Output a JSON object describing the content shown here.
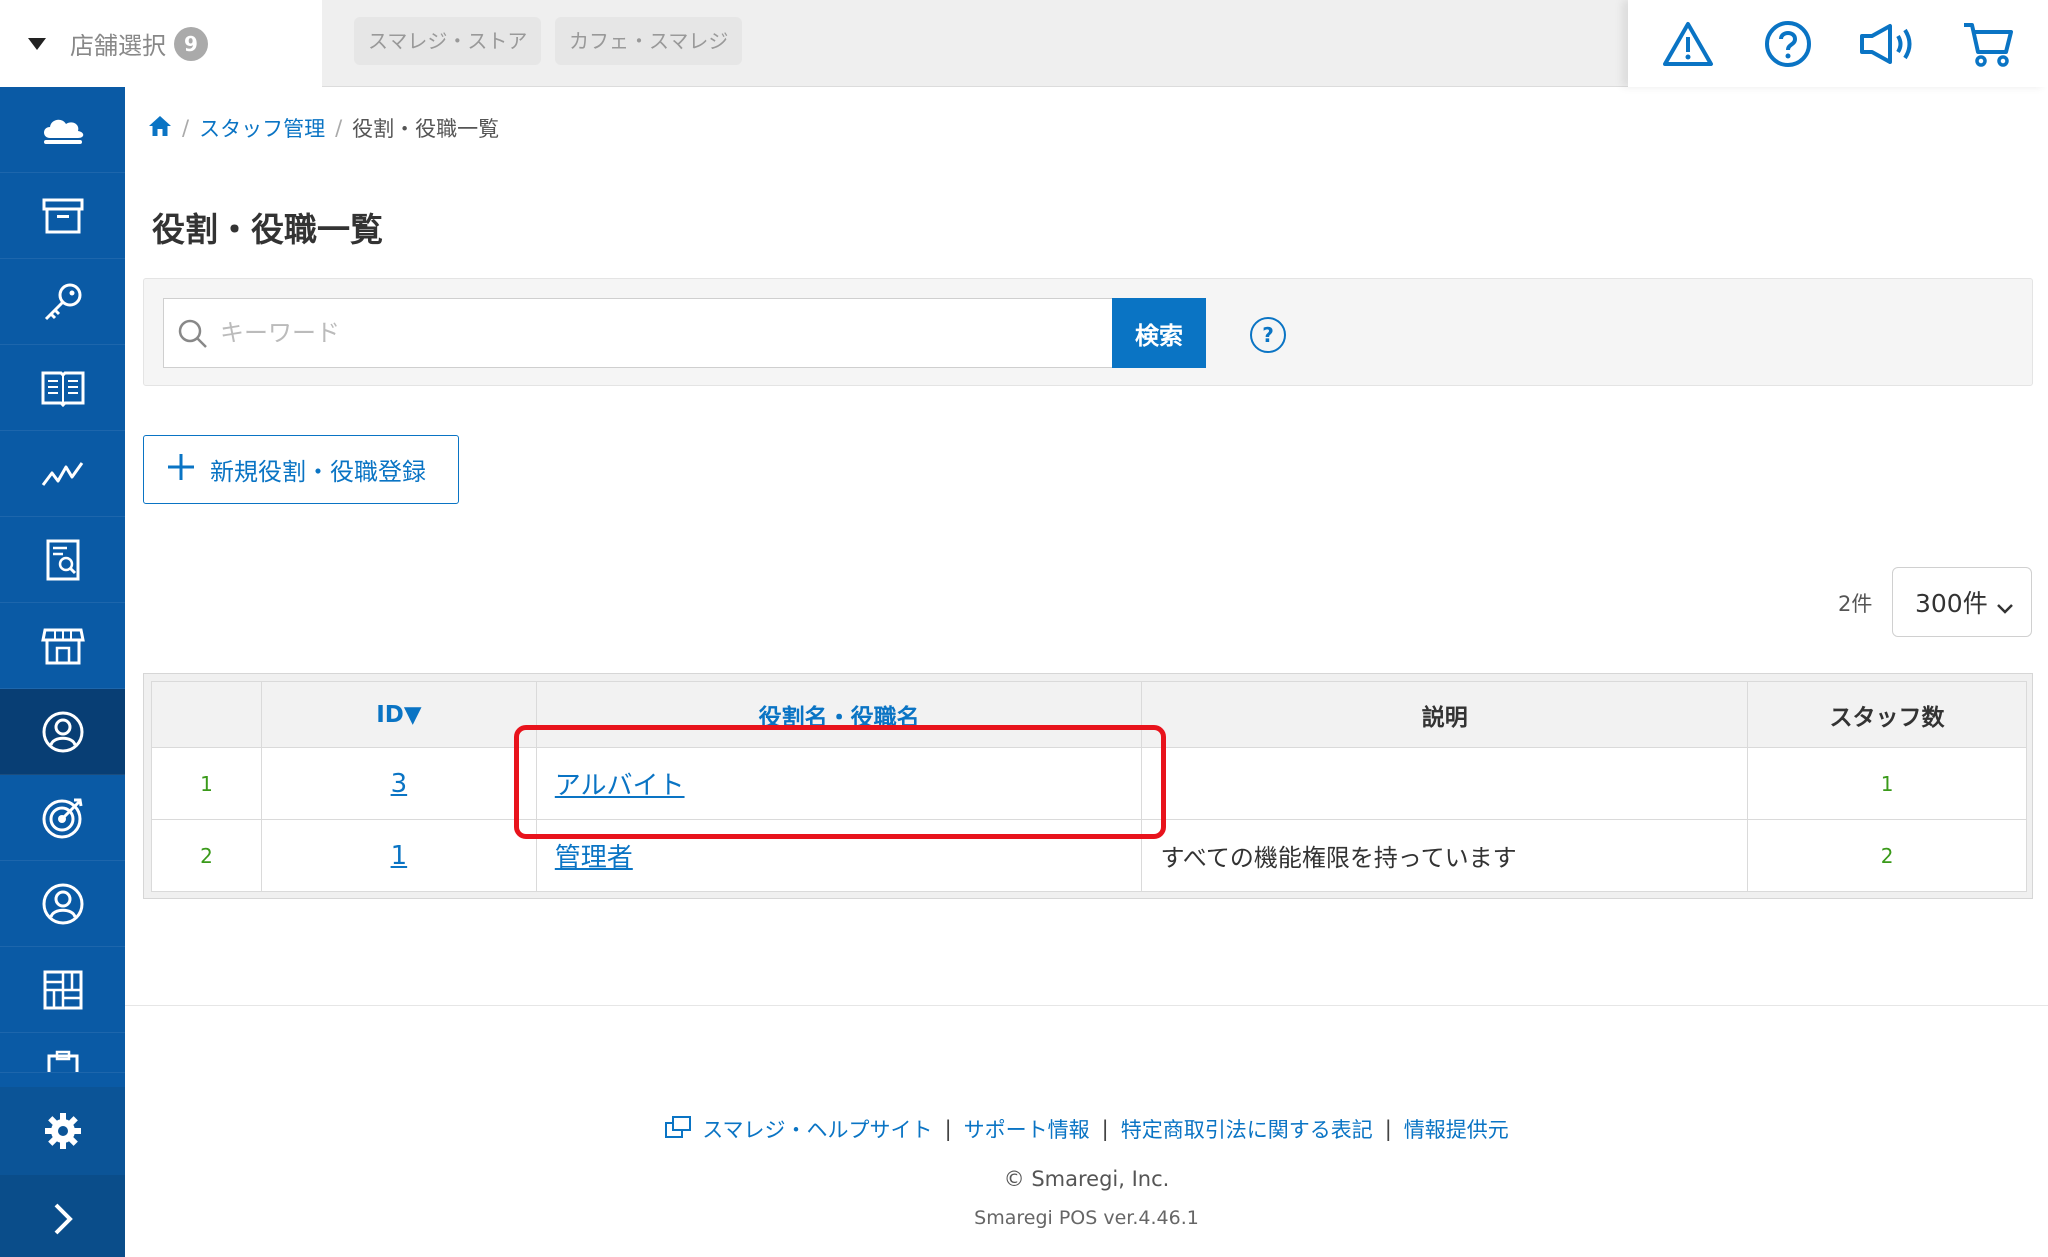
{
  "topbar": {
    "store_select_label": "店舗選択",
    "store_count": "9",
    "stores": [
      "スマレジ・ストア",
      "カフェ・スマレジ"
    ],
    "icons": [
      "warning-icon",
      "help-icon",
      "megaphone-icon",
      "cart-icon"
    ]
  },
  "sidebar": {
    "items": [
      "cloud-icon",
      "archive-box-icon",
      "key-icon",
      "book-icon",
      "chart-line-icon",
      "report-icon",
      "store-icon",
      "staff-icon",
      "target-icon",
      "customer-icon",
      "grid-icon",
      "clipboard-icon"
    ],
    "active": "staff-icon",
    "bottom": [
      "gear-icon",
      "chevron-right-icon"
    ]
  },
  "breadcrumb": {
    "home_icon": "home-icon",
    "items": [
      "スタッフ管理",
      "役割・役職一覧"
    ]
  },
  "page": {
    "title": "役割・役職一覧"
  },
  "search": {
    "placeholder": "キーワード",
    "button_label": "検索",
    "help_label": "?"
  },
  "actions": {
    "new_button_label": "新規役割・役職登録"
  },
  "pagination": {
    "count_label": "2件",
    "per_page": "300件"
  },
  "table": {
    "headers": [
      "",
      "ID▼",
      "役割名・役職名",
      "説明",
      "スタッフ数"
    ],
    "rows": [
      {
        "no": "1",
        "id": "3",
        "name": "アルバイト",
        "description": "",
        "staff_count": "1"
      },
      {
        "no": "2",
        "id": "1",
        "name": "管理者",
        "description": "すべての機能権限を持っています",
        "staff_count": "2"
      }
    ]
  },
  "footer": {
    "links": [
      "スマレジ・ヘルプサイト",
      "サポート情報",
      "特定商取引法に関する表記",
      "情報提供元"
    ],
    "separator": "|",
    "copyright": "© Smaregi, Inc.",
    "version": "Smaregi POS ver.4.46.1"
  },
  "colors": {
    "sidebar": "#0a5aa5",
    "accent": "#0a74c4",
    "highlight": "#e8131c",
    "count_green": "#3a9a1a"
  }
}
